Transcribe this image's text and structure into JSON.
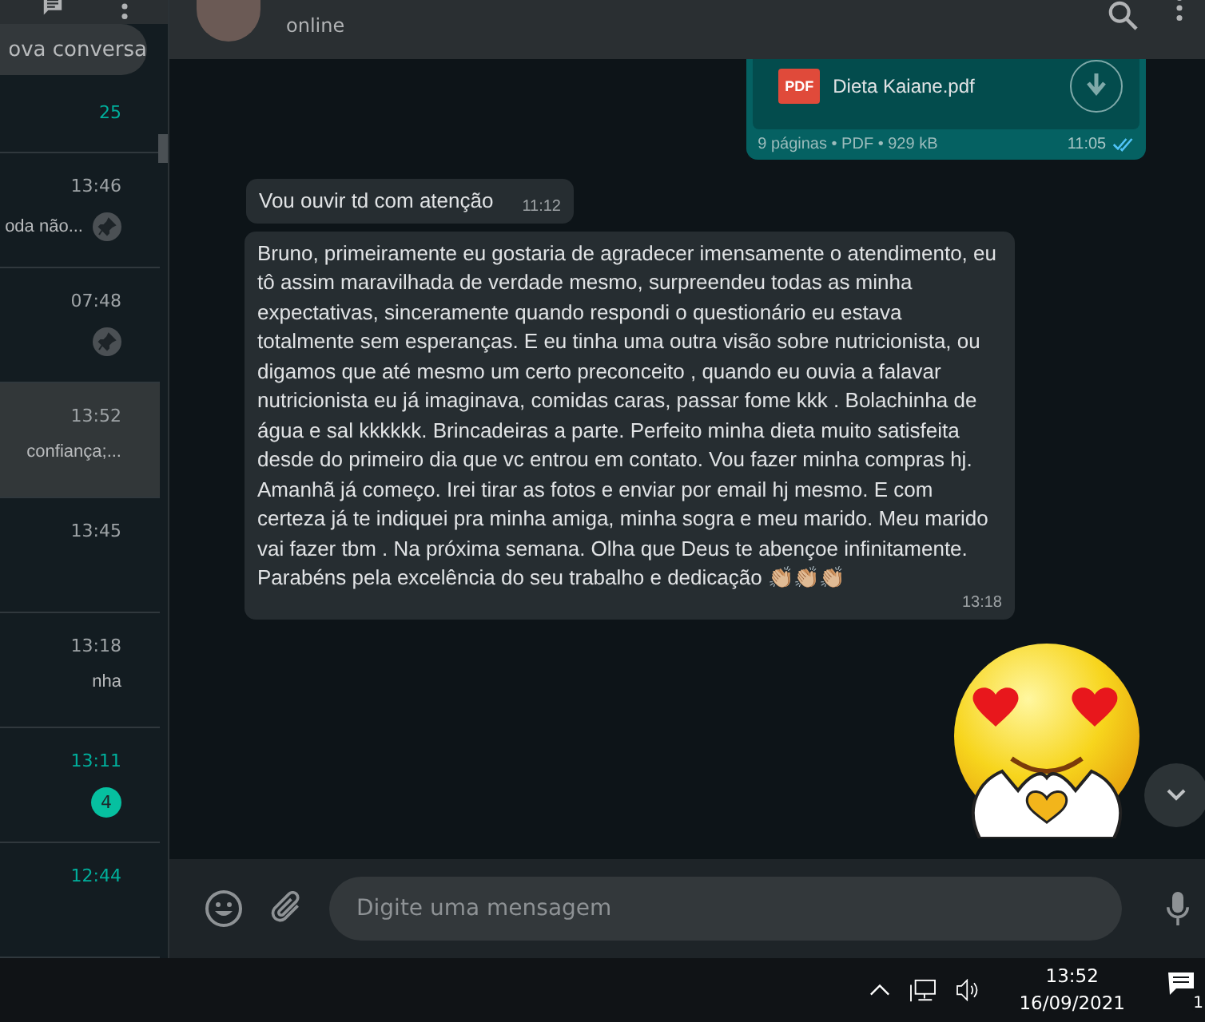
{
  "sidebar": {
    "search": {
      "placeholder": "ova conversa"
    },
    "chats": [
      {
        "time": "25",
        "pinned": false,
        "unread": true,
        "selected": false
      },
      {
        "time": "13:46",
        "preview": "oda não...",
        "pinned": true,
        "unread": false,
        "selected": false
      },
      {
        "time": "07:48",
        "pinned": true,
        "unread": false,
        "selected": false
      },
      {
        "time": "13:52",
        "preview": "confiança;...",
        "pinned": false,
        "unread": false,
        "selected": true
      },
      {
        "time": "13:45",
        "pinned": false,
        "unread": false,
        "selected": false
      },
      {
        "time": "13:18",
        "preview": "nha",
        "pinned": false,
        "unread": false,
        "selected": false
      },
      {
        "time": "13:11",
        "pinned": false,
        "badge": "4",
        "unread": true,
        "selected": false
      },
      {
        "time": "12:44",
        "pinned": false,
        "unread": true,
        "selected": false
      }
    ]
  },
  "chat": {
    "status": "online",
    "messages": [
      {
        "kind": "document",
        "outgoing": true,
        "file_type": "PDF",
        "name": "Dieta Kaiane.pdf",
        "meta": "9 páginas • PDF • 929 kB",
        "time": "11:05",
        "read": true
      },
      {
        "kind": "text",
        "outgoing": false,
        "text": "Vou ouvir td com atenção",
        "time": "11:12"
      },
      {
        "kind": "text",
        "outgoing": false,
        "text": "Bruno, primeiramente eu gostaria de agradecer imensamente o atendimento, eu tô assim maravilhada de verdade mesmo, surpreendeu todas as minha expectativas, sinceramente quando respondi o questionário eu estava totalmente sem esperanças. E eu tinha uma outra visão sobre nutricionista, ou digamos que até mesmo um certo preconceito , quando eu ouvia a falavar nutricionista eu já imaginava, comidas caras, passar fome kkk . Bolachinha de água e sal kkkkkk. Brincadeiras a parte. Perfeito minha dieta muito satisfeita desde do primeiro dia que vc entrou em contato. Vou fazer minha compras hj. Amanhã já começo. Irei tirar as fotos e enviar por email hj mesmo. E com certeza já te indiquei pra minha amiga, minha sogra e meu marido. Meu marido vai fazer tbm . Na próxima semana. Olha que Deus te abençoe infinitamente. Parabéns pela excelência do seu trabalho e dedicação 👏🏼👏🏼👏🏼",
        "time": "13:18"
      },
      {
        "kind": "sticker",
        "outgoing": true
      }
    ],
    "composer": {
      "placeholder": "Digite uma mensagem"
    }
  },
  "taskbar": {
    "time": "13:52",
    "date": "16/09/2021",
    "notifications": "1"
  }
}
